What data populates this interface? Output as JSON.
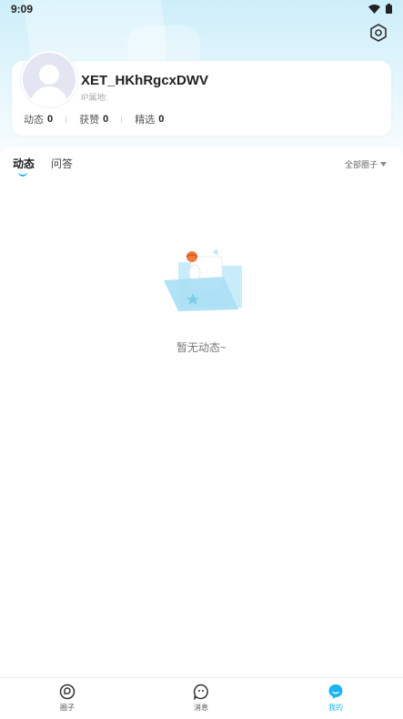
{
  "status_bar": {
    "time": "9:09",
    "icons": [
      "wifi-icon",
      "battery-icon"
    ]
  },
  "header": {
    "settings_icon": "hexagon-settings-icon"
  },
  "profile": {
    "username": "XET_HKhRgcxDWV",
    "ip_label": "IP属地:",
    "stats": [
      {
        "label": "动态",
        "value": "0"
      },
      {
        "label": "获赞",
        "value": "0"
      },
      {
        "label": "精选",
        "value": "0"
      }
    ]
  },
  "tabs": {
    "items": [
      {
        "label": "动态",
        "active": true
      },
      {
        "label": "问答",
        "active": false
      }
    ],
    "filter_label": "全部圈子"
  },
  "empty_state": {
    "text": "暂无动态~"
  },
  "bottom_nav": {
    "items": [
      {
        "label": "圈子",
        "icon": "circle-icon",
        "active": false
      },
      {
        "label": "消息",
        "icon": "message-icon",
        "active": false
      },
      {
        "label": "我的",
        "icon": "profile-icon",
        "active": true
      }
    ]
  },
  "colors": {
    "accent": "#18b5f0",
    "text_primary": "#1f1f1f",
    "text_secondary": "#a8a8a8"
  }
}
